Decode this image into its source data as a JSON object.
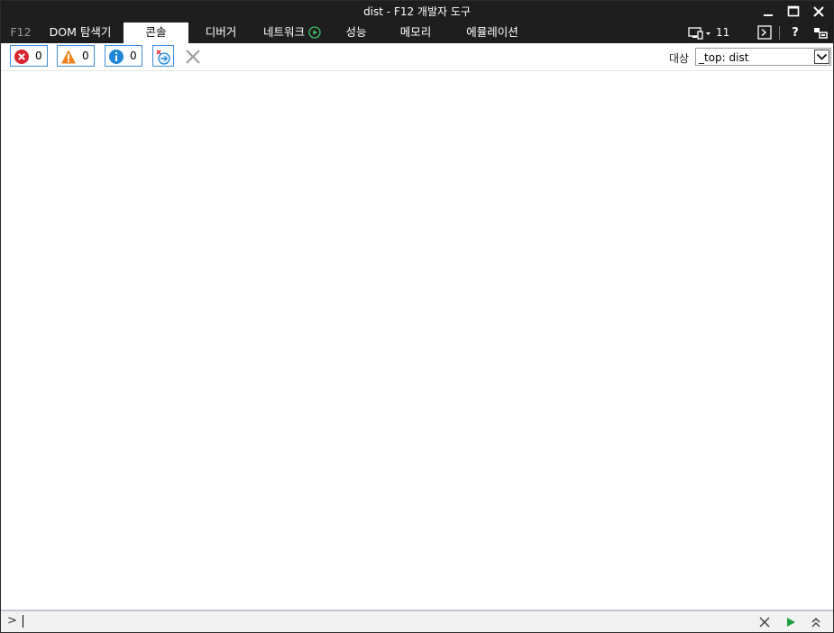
{
  "window": {
    "title": "dist - F12 개발자 도구"
  },
  "tabs": {
    "f12": "F12",
    "dom": "DOM 탐색기",
    "console": "콘솔",
    "debugger": "디버거",
    "network": "네트워크",
    "performance": "성능",
    "memory": "메모리",
    "emulation": "에뮬레이션"
  },
  "right_tools": {
    "document_mode": "11"
  },
  "toolbar": {
    "errors_count": "0",
    "warnings_count": "0",
    "messages_count": "0",
    "target_label": "대상",
    "target_value": "_top: dist"
  },
  "input": {
    "prompt": ">",
    "value": ""
  },
  "colors": {
    "titlebar": "#1e1e1e",
    "error": "#d9252c",
    "warning": "#f0861b",
    "info": "#1e88d6",
    "run": "#1f9e3a"
  }
}
